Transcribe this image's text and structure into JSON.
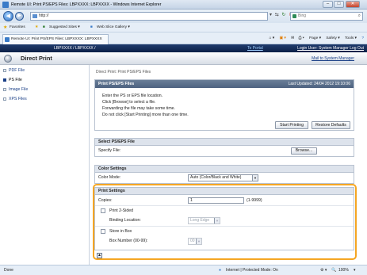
{
  "window": {
    "title": "Remote UI: Print PS/EPS Files: LBPXXXX: LBPXXXX - Windows Internet Explorer"
  },
  "browser": {
    "address": "http://",
    "search_placeholder": "Bing",
    "favorites_label": "Favorites",
    "suggested_sites": "Suggested Sites ▾",
    "web_slice_gallery": "Web Slice Gallery ▾",
    "tab_title": "Remote UI: Print PS/EPS Files: LBPXXXX: LBPXXXX",
    "cmd_page": "Page ▾",
    "cmd_safety": "Safety ▾",
    "cmd_tools": "Tools ▾",
    "cmd_help": "?"
  },
  "header": {
    "device": "LBPXXXX / LBPXXXX /",
    "to_portal": "To Portal",
    "login_user": "Login User: System Manager Log Out",
    "app_title": "Direct Print",
    "mail": "Mail to System Manager"
  },
  "sidebar": {
    "items": [
      {
        "label": "PDF File",
        "active": false
      },
      {
        "label": "PS File",
        "active": true
      },
      {
        "label": "Image File",
        "active": false
      },
      {
        "label": "XPS Files",
        "active": false
      }
    ]
  },
  "main": {
    "breadcrumb": "Direct Print: Print PS/EPS Files",
    "panel_title": "Print PS/EPS Files",
    "last_updated": "Last Updated: 24/04 2012 19:10:06",
    "instructions": [
      "Enter the PS or EPS file location.",
      "Click [Browse] to select a file.",
      "Forwarding the file may take some time.",
      "Do not click [Start Printing] more than one time."
    ],
    "start_printing": "Start Printing",
    "restore_defaults": "Restore Defaults",
    "select_file": {
      "heading": "Select PS/EPS File",
      "label": "Specify File:",
      "browse": "Browse..."
    },
    "color_settings": {
      "heading": "Color Settings",
      "label": "Color Mode:",
      "value": "Auto (Color/Black and White)"
    },
    "print_settings": {
      "heading": "Print Settings",
      "copies_label": "Copies:",
      "copies_value": "1",
      "copies_range": "(1-9999)",
      "print_2sided": "Print 2-Sided",
      "binding_label": "Binding Location:",
      "binding_value": "Long Edge",
      "store_in_box": "Store in Box",
      "box_number_label": "Box Number (00-99):",
      "box_number_value": "00"
    }
  },
  "status": {
    "left": "Done",
    "zone": "Internet | Protected Mode: On",
    "zoom": "100%"
  }
}
